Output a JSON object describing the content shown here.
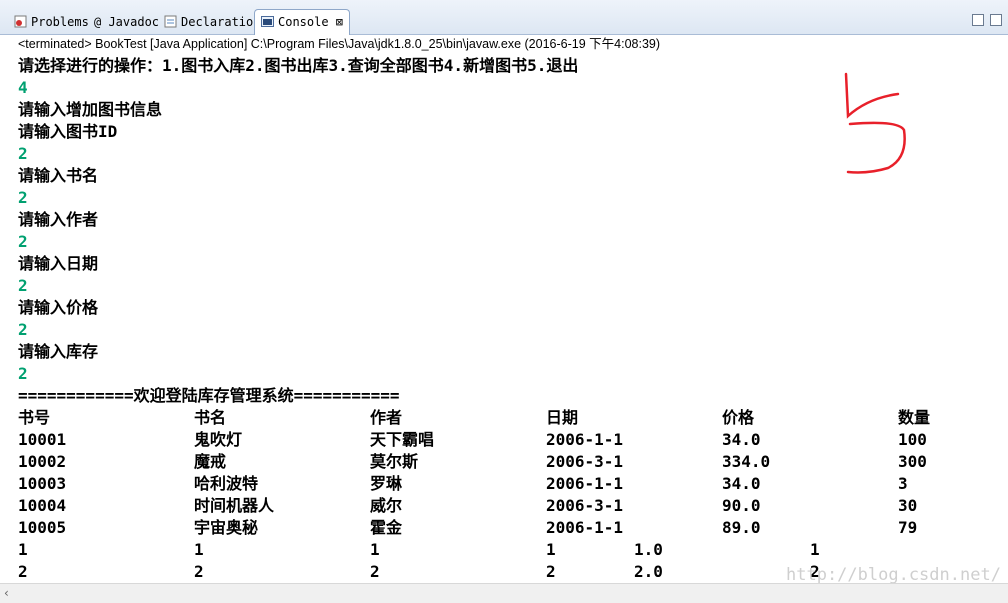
{
  "tabs": [
    {
      "label": "Problems"
    },
    {
      "label": "@ Javadoc"
    },
    {
      "label": "Declaration"
    },
    {
      "label": "Console ⊠"
    }
  ],
  "status_line": "<terminated> BookTest [Java Application] C:\\Program Files\\Java\\jdk1.8.0_25\\bin\\javaw.exe (2016-6-19 下午4:08:39)",
  "lines": [
    {
      "text": "请选择进行的操作：1.图书入库2.图书出库3.查询全部图书4.新增图书5.退出",
      "input": false
    },
    {
      "text": "4",
      "input": true
    },
    {
      "text": "请输入增加图书信息",
      "input": false
    },
    {
      "text": "请输入图书ID",
      "input": false
    },
    {
      "text": "2",
      "input": true
    },
    {
      "text": "请输入书名",
      "input": false
    },
    {
      "text": "2",
      "input": true
    },
    {
      "text": "请输入作者",
      "input": false
    },
    {
      "text": "2",
      "input": true
    },
    {
      "text": "请输入日期",
      "input": false
    },
    {
      "text": "2",
      "input": true
    },
    {
      "text": "请输入价格",
      "input": false
    },
    {
      "text": "2",
      "input": true
    },
    {
      "text": "请输入库存",
      "input": false
    },
    {
      "text": "2",
      "input": true
    },
    {
      "text": "============欢迎登陆库存管理系统===========",
      "input": false
    }
  ],
  "table": {
    "headers": [
      "书号",
      "书名",
      "作者",
      "日期",
      "价格",
      "数量"
    ],
    "rows": [
      [
        "10001",
        "鬼吹灯",
        "天下霸唱",
        "2006-1-1",
        "34.0",
        "100"
      ],
      [
        "10002",
        "魔戒",
        "莫尔斯",
        "2006-3-1",
        "334.0",
        "300"
      ],
      [
        "10003",
        "哈利波特",
        "罗琳",
        "2006-1-1",
        "34.0",
        "3"
      ],
      [
        "10004",
        "时间机器人",
        "威尔",
        "2006-3-1",
        "90.0",
        "30"
      ],
      [
        "10005",
        "宇宙奥秘",
        "霍金",
        "2006-1-1",
        "89.0",
        "79"
      ]
    ],
    "short_rows": [
      [
        "1",
        "1",
        "1",
        "1",
        "1.0",
        "1"
      ],
      [
        "2",
        "2",
        "2",
        "2",
        "2.0",
        "2"
      ]
    ]
  },
  "watermark": "http://blog.csdn.net/",
  "colors": {
    "input_text": "#00a070",
    "annotation": "#e8202a"
  }
}
